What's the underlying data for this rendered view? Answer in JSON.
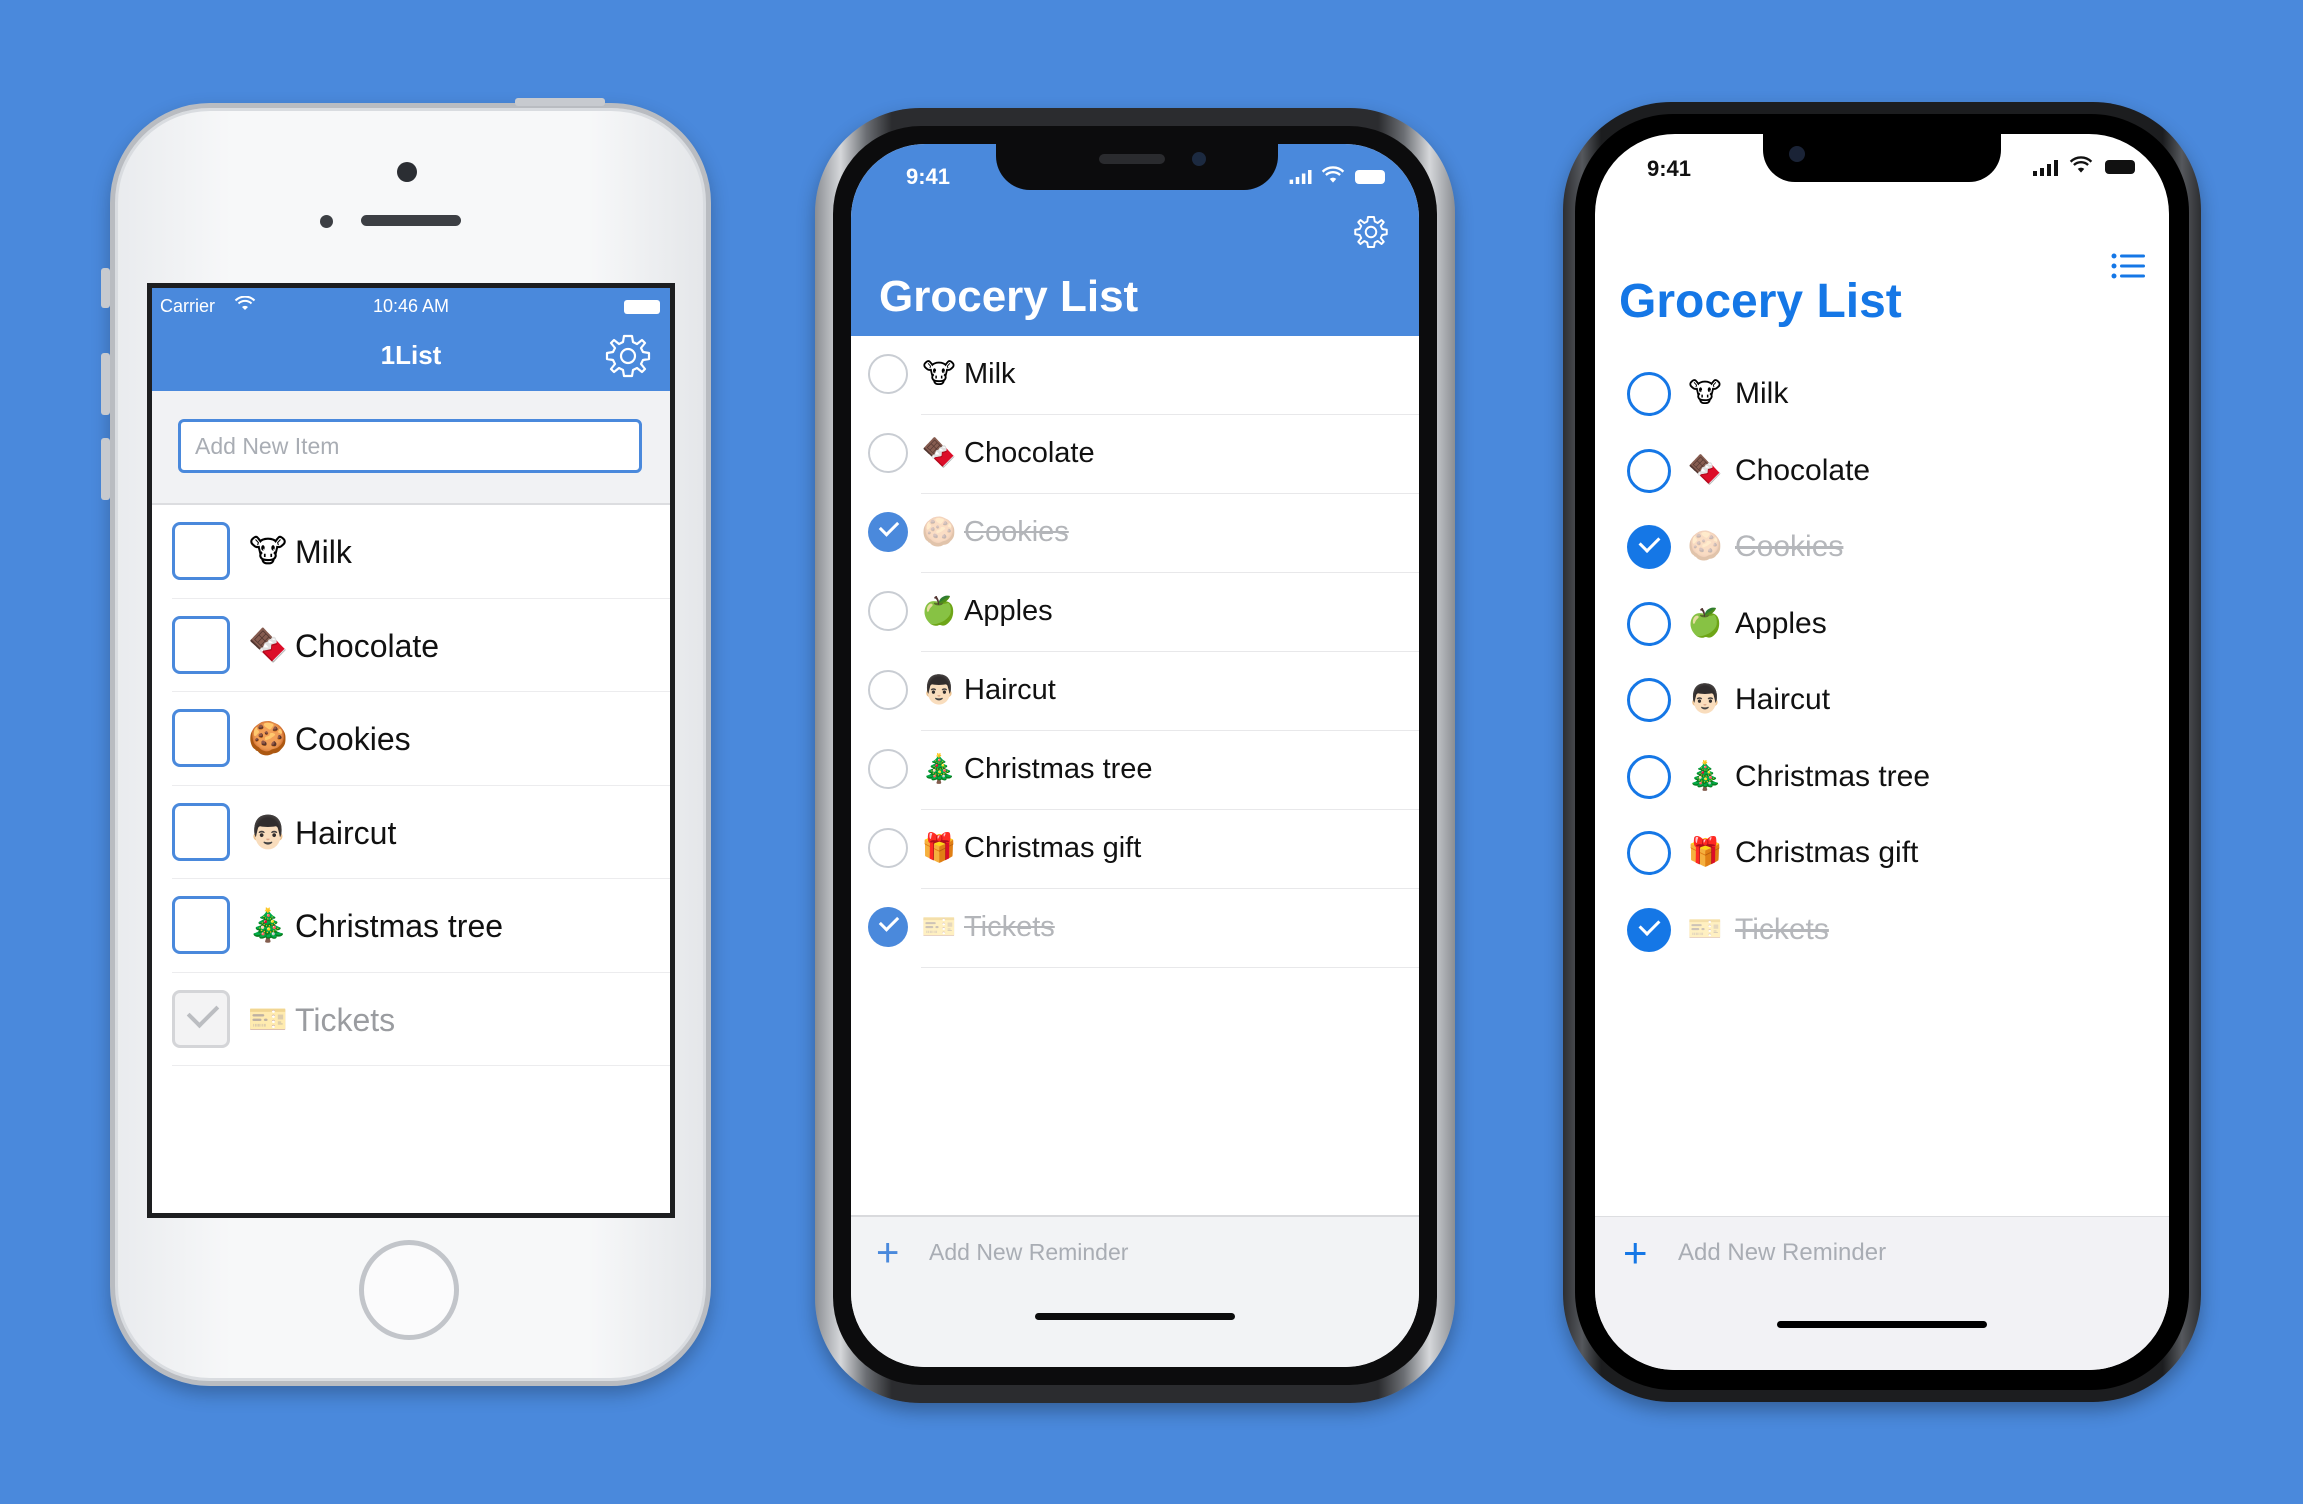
{
  "phone1": {
    "status": {
      "carrier": "Carrier",
      "time": "10:46 AM"
    },
    "title": "1List",
    "add_placeholder": "Add New Item",
    "items": [
      {
        "emoji": "🐮",
        "label": "Milk",
        "done": false
      },
      {
        "emoji": "🍫",
        "label": "Chocolate",
        "done": false
      },
      {
        "emoji": "🍪",
        "label": "Cookies",
        "done": false
      },
      {
        "emoji": "👨🏻",
        "label": "Haircut",
        "done": false
      },
      {
        "emoji": "🎄",
        "label": "Christmas tree",
        "done": false
      },
      {
        "emoji": "🎫",
        "label": "Tickets",
        "done": true
      }
    ],
    "accent": "#4a89dc"
  },
  "phone2": {
    "status": {
      "time": "9:41"
    },
    "title": "Grocery List",
    "add_label": "Add New Reminder",
    "plus_glyph": "+",
    "items": [
      {
        "emoji": "🐮",
        "label": "Milk",
        "done": false
      },
      {
        "emoji": "🍫",
        "label": "Chocolate",
        "done": false
      },
      {
        "emoji": "🍪",
        "label": "Cookies",
        "done": true
      },
      {
        "emoji": "🍏",
        "label": "Apples",
        "done": false
      },
      {
        "emoji": "👨🏻",
        "label": "Haircut",
        "done": false
      },
      {
        "emoji": "🎄",
        "label": "Christmas tree",
        "done": false
      },
      {
        "emoji": "🎁",
        "label": "Christmas gift",
        "done": false
      },
      {
        "emoji": "🎫",
        "label": "Tickets",
        "done": true
      }
    ],
    "accent": "#4a89dc"
  },
  "phone3": {
    "status": {
      "time": "9:41"
    },
    "title": "Grocery List",
    "add_label": "Add New Reminder",
    "plus_glyph": "+",
    "items": [
      {
        "emoji": "🐮",
        "label": "Milk",
        "done": false
      },
      {
        "emoji": "🍫",
        "label": "Chocolate",
        "done": false
      },
      {
        "emoji": "🍪",
        "label": "Cookies",
        "done": true
      },
      {
        "emoji": "🍏",
        "label": "Apples",
        "done": false
      },
      {
        "emoji": "👨🏻",
        "label": "Haircut",
        "done": false
      },
      {
        "emoji": "🎄",
        "label": "Christmas tree",
        "done": false
      },
      {
        "emoji": "🎁",
        "label": "Christmas gift",
        "done": false
      },
      {
        "emoji": "🎫",
        "label": "Tickets",
        "done": true
      }
    ],
    "accent": "#1577e6"
  },
  "icons": {
    "gear": "gear-icon",
    "list": "list-icon",
    "wifi": "wifi-icon",
    "signal": "signal-icon",
    "battery": "battery-icon",
    "checkmark": "checkmark-icon",
    "plus": "plus-icon"
  },
  "background_color": "#4a89dc"
}
